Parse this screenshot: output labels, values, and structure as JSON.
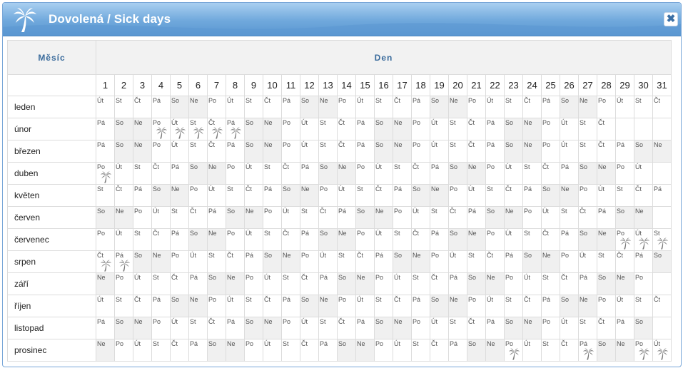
{
  "dialog": {
    "title": "Dovolená / Sick days",
    "close_symbol": "✖",
    "title_icon": "palm-tree-icon",
    "cell_icon": "palm-tree-icon"
  },
  "table": {
    "header_month": "Měsíc",
    "header_day": "Den",
    "days": [
      "1",
      "2",
      "3",
      "4",
      "5",
      "6",
      "7",
      "8",
      "9",
      "10",
      "11",
      "12",
      "13",
      "14",
      "15",
      "16",
      "17",
      "18",
      "19",
      "20",
      "21",
      "22",
      "23",
      "24",
      "25",
      "26",
      "27",
      "28",
      "29",
      "30",
      "31"
    ],
    "months": [
      {
        "name": "leden",
        "first": "Út",
        "len": 31,
        "marks": []
      },
      {
        "name": "únor",
        "first": "Pá",
        "len": 28,
        "marks": [
          4,
          5,
          6,
          7,
          8
        ]
      },
      {
        "name": "březen",
        "first": "Pá",
        "len": 31,
        "marks": []
      },
      {
        "name": "duben",
        "first": "Po",
        "len": 30,
        "marks": [
          1
        ]
      },
      {
        "name": "květen",
        "first": "St",
        "len": 31,
        "marks": []
      },
      {
        "name": "červen",
        "first": "So",
        "len": 30,
        "marks": []
      },
      {
        "name": "červenec",
        "first": "Po",
        "len": 31,
        "marks": [
          29,
          30,
          31
        ]
      },
      {
        "name": "srpen",
        "first": "Čt",
        "len": 31,
        "marks": [
          1,
          2
        ]
      },
      {
        "name": "září",
        "first": "Ne",
        "len": 30,
        "marks": []
      },
      {
        "name": "říjen",
        "first": "Út",
        "len": 31,
        "marks": []
      },
      {
        "name": "listopad",
        "first": "Pá",
        "len": 30,
        "marks": []
      },
      {
        "name": "prosinec",
        "first": "Ne",
        "len": 31,
        "marks": [
          23,
          27,
          30,
          31
        ]
      }
    ],
    "weekdays": [
      "Po",
      "Út",
      "St",
      "Čt",
      "Pá",
      "So",
      "Ne"
    ]
  }
}
